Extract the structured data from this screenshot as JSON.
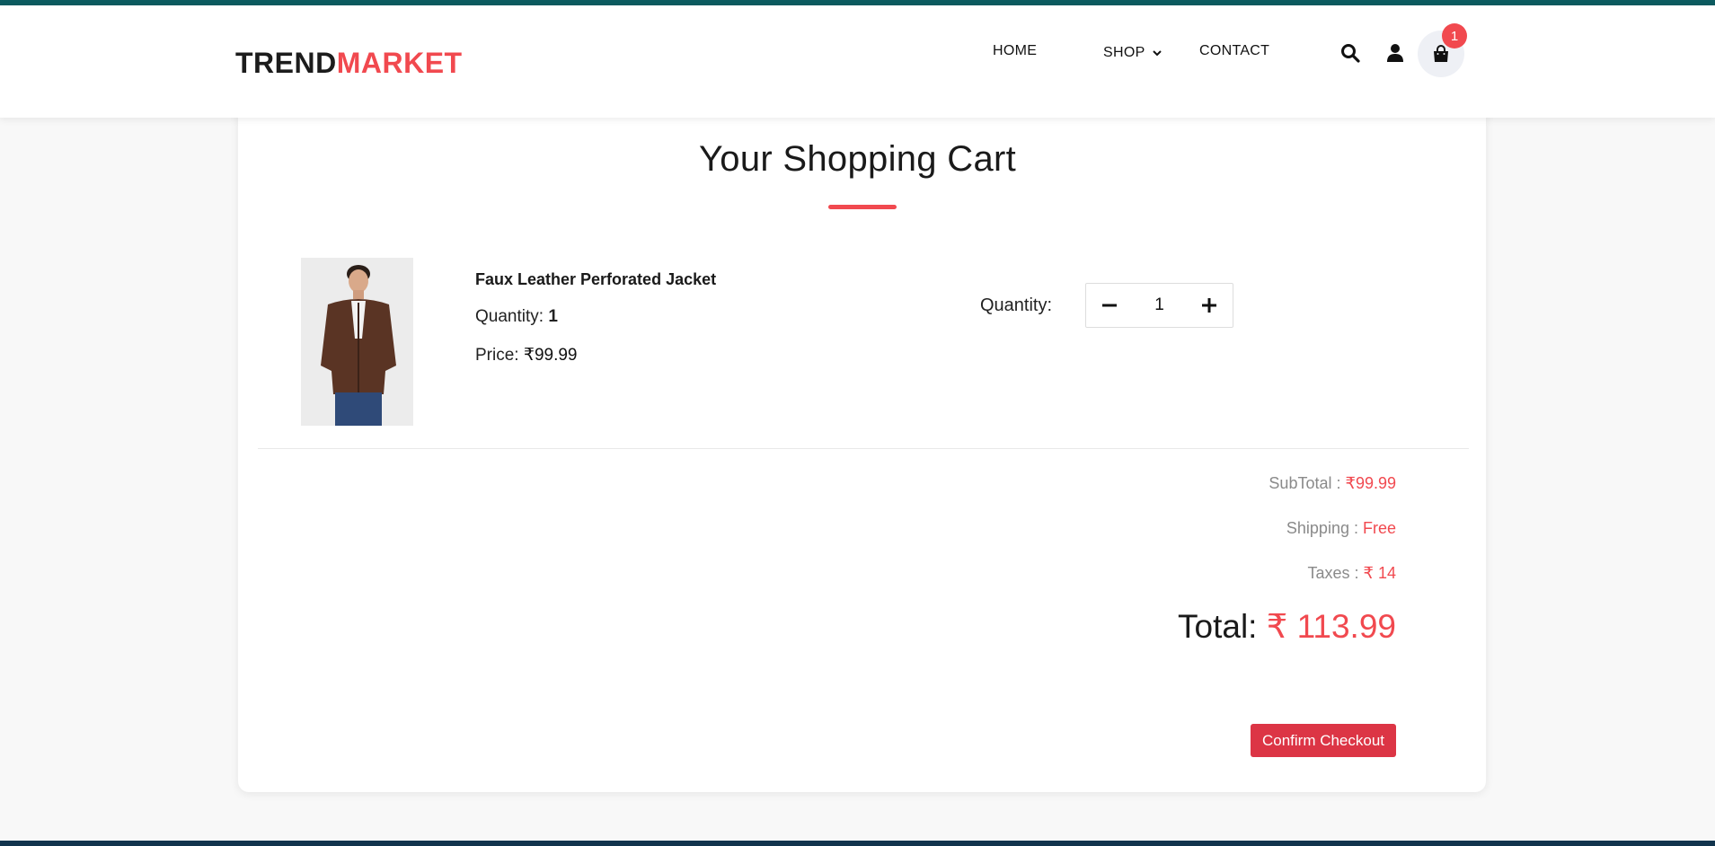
{
  "brand": {
    "part1": "TREND",
    "part2": "MARKET"
  },
  "nav": {
    "home": "HOME",
    "shop": "SHOP",
    "contact": "CONTACT"
  },
  "icons": {
    "search": "search-icon",
    "user": "user-icon",
    "cart": "shopping-bag-icon",
    "shop_dropdown": "chevron-down-icon"
  },
  "cart": {
    "badge_count": "1"
  },
  "page": {
    "title": "Your Shopping Cart"
  },
  "item": {
    "name": "Faux Leather Perforated Jacket",
    "quantity_label": "Quantity:",
    "quantity_value": "1",
    "price_label": "Price:",
    "price_value": "₹99.99"
  },
  "stepper": {
    "label": "Quantity:",
    "value": "1"
  },
  "summary": {
    "subtotal_label": "SubTotal :",
    "subtotal_value": "₹99.99",
    "shipping_label": "Shipping :",
    "shipping_value": "Free",
    "taxes_label": "Taxes :",
    "taxes_value": "₹ 14",
    "total_label": "Total:",
    "total_value": "₹ 113.99"
  },
  "checkout": {
    "label": "Confirm Checkout"
  },
  "colors": {
    "accent": "#f1494f",
    "button": "#dc3545",
    "top_stripe": "#0c5b60",
    "bottom_stripe": "#12344d"
  }
}
